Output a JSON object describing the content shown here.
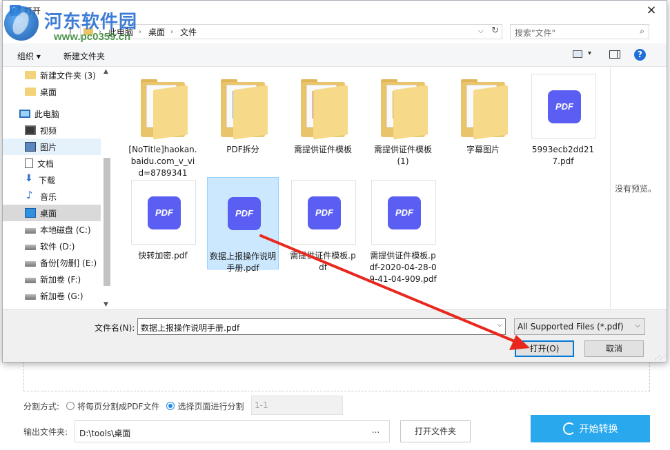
{
  "dialog": {
    "title": "打开",
    "close": "×"
  },
  "watermark": {
    "name": "河东软件园",
    "url": "www.pc0359.cn"
  },
  "address": {
    "up_icon": "↑",
    "crumbs": [
      "此电脑",
      "桌面",
      "文件"
    ],
    "separator": "›",
    "dropdown": "⌵",
    "refresh": "↻"
  },
  "search": {
    "placeholder": "搜索\"文件\"",
    "icon": "⌕"
  },
  "toolbar": {
    "organize": "组织 ▾",
    "new_folder": "新建文件夹",
    "help": "?",
    "view_dropdown": "▾"
  },
  "nav": {
    "scroll_up": "▲",
    "scroll_down": "▼",
    "items": [
      {
        "label": "新建文件夹 (3)",
        "icon": "folder-icon"
      },
      {
        "label": "桌面",
        "icon": "folder-icon"
      },
      {
        "label": "此电脑",
        "icon": "pc-icon"
      },
      {
        "label": "视频",
        "icon": "video-icon"
      },
      {
        "label": "图片",
        "icon": "picture-icon"
      },
      {
        "label": "文档",
        "icon": "document-icon"
      },
      {
        "label": "下载",
        "icon": "download-icon"
      },
      {
        "label": "音乐",
        "icon": "music-icon"
      },
      {
        "label": "桌面",
        "icon": "desktop-icon"
      },
      {
        "label": "本地磁盘 (C:)",
        "icon": "drive-icon"
      },
      {
        "label": "软件 (D:)",
        "icon": "drive-icon"
      },
      {
        "label": "备份[勿删] (E:)",
        "icon": "drive-icon"
      },
      {
        "label": "新加卷 (F:)",
        "icon": "drive-icon"
      },
      {
        "label": "新加卷 (G:)",
        "icon": "drive-icon"
      }
    ]
  },
  "files": [
    {
      "name": "[NoTitle]haokan.baidu.com_v_vid=8789341",
      "type": "folder"
    },
    {
      "name": "PDF拆分",
      "type": "folder"
    },
    {
      "name": "需提供证件模板",
      "type": "folder"
    },
    {
      "name": "需提供证件模板 (1)",
      "type": "folder"
    },
    {
      "name": "字幕图片",
      "type": "folder"
    },
    {
      "name": "5993ecb2dd217.pdf",
      "type": "pdf"
    },
    {
      "name": "快转加密.pdf",
      "type": "pdf"
    },
    {
      "name": "数据上报操作说明手册.pdf",
      "type": "pdf",
      "selected": true
    },
    {
      "name": "需提供证件模板.pdf",
      "type": "pdf"
    },
    {
      "name": "需提供证件模板.pdf-2020-04-28-09-41-04-909.pdf",
      "type": "pdf"
    }
  ],
  "pdf_badge": "PDF",
  "preview": {
    "text": "没有预览。"
  },
  "bottom": {
    "filename_label": "文件名(N):",
    "filename_value": "数据上报操作说明手册.pdf",
    "filter": "All Supported Files (*.pdf)",
    "open": "打开(O)",
    "cancel": "取消",
    "dd": "⌵"
  },
  "background_app": {
    "split_label": "分割方式:",
    "option_each_page": "将每页分割成PDF文件",
    "option_select_pages": "选择页面进行分割",
    "range_value": "1-1",
    "output_label": "输出文件夹:",
    "output_path": "D:\\tools\\桌面",
    "browse": "...",
    "open_folder": "打开文件夹",
    "start": "开始转换"
  },
  "colors": {
    "accent": "#0078d7",
    "start_button": "#2aa8ee",
    "pdf_badge": "#5b5ef2",
    "selection": "#cce8ff",
    "annotation_arrow": "#e8281e"
  }
}
